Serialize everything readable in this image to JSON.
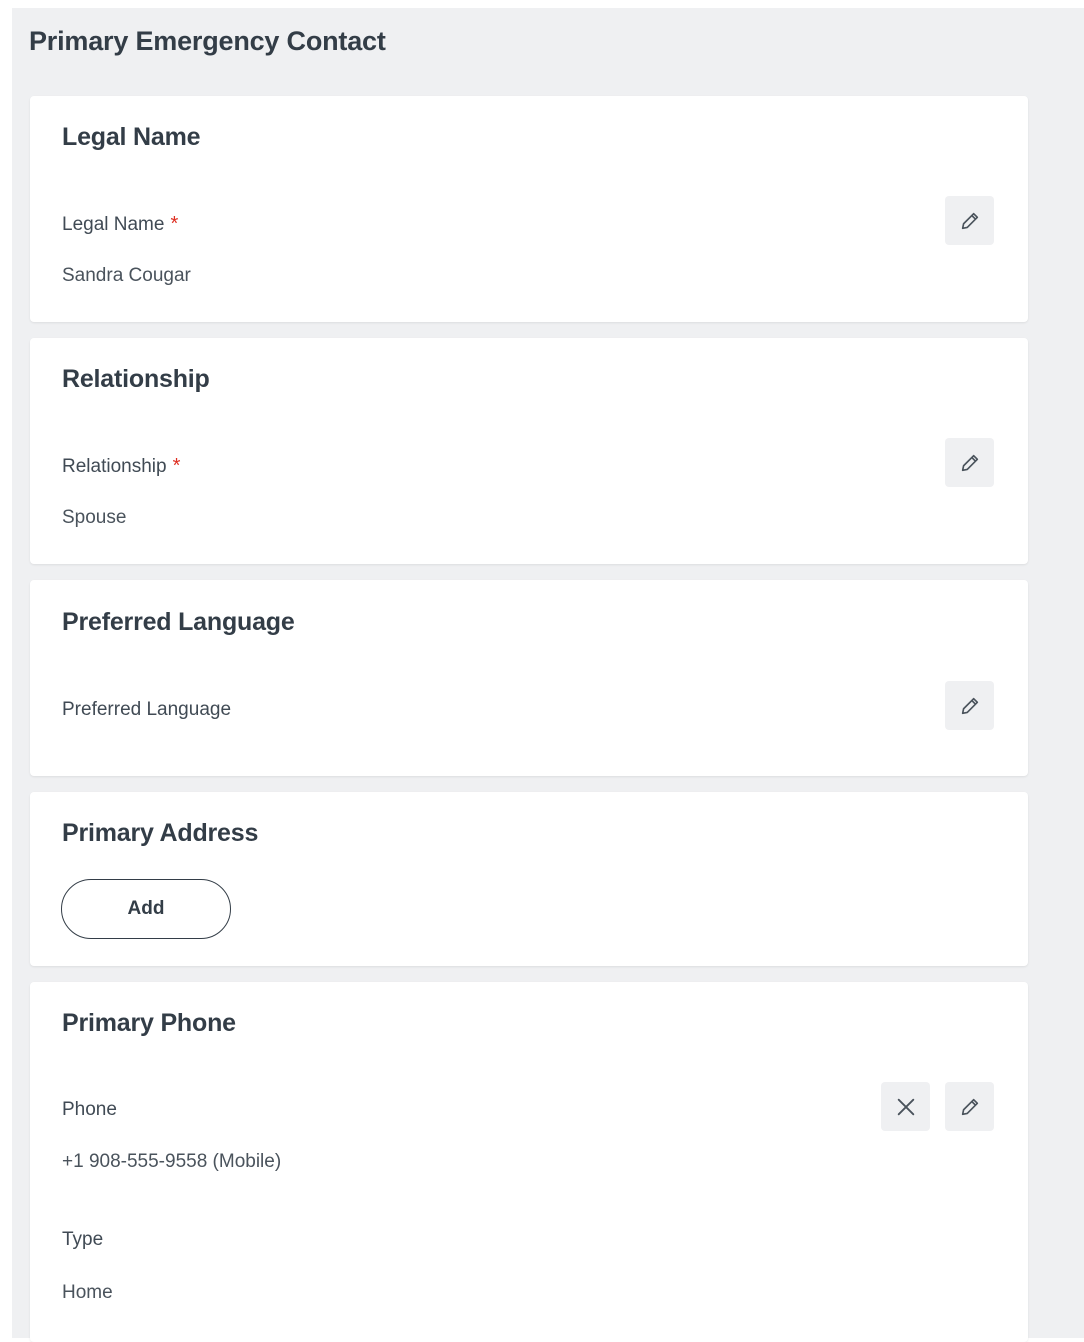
{
  "page": {
    "title": "Primary Emergency Contact"
  },
  "legal_name": {
    "title": "Legal Name",
    "field_label": "Legal Name",
    "required_mark": "*",
    "value": "Sandra Cougar"
  },
  "relationship": {
    "title": "Relationship",
    "field_label": "Relationship",
    "required_mark": "*",
    "value": "Spouse"
  },
  "preferred_language": {
    "title": "Preferred Language",
    "field_label": "Preferred Language"
  },
  "primary_address": {
    "title": "Primary Address",
    "add_label": "Add"
  },
  "primary_phone": {
    "title": "Primary Phone",
    "phone_label": "Phone",
    "phone_value": "+1 908-555-9558 (Mobile)",
    "type_label": "Type",
    "type_value": "Home"
  },
  "icons": {
    "edit": "pencil-icon",
    "remove": "close-icon"
  },
  "colors": {
    "panel_background": "#eff0f2",
    "required": "#de2e21",
    "text": "#333d47"
  }
}
